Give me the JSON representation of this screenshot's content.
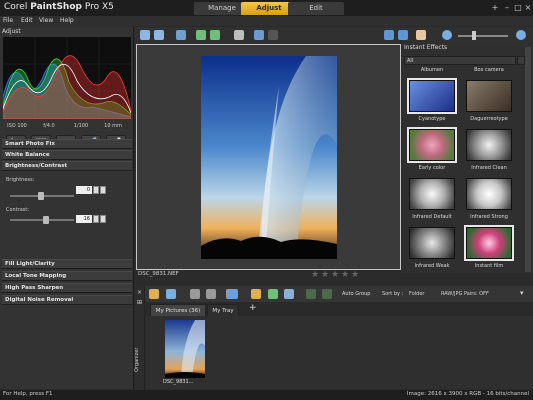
{
  "app": {
    "brand": "Corel",
    "product": "PaintShop",
    "version": "Pro X5"
  },
  "mode_tabs": [
    {
      "label": "Manage",
      "active": false
    },
    {
      "label": "Adjust",
      "active": true
    },
    {
      "label": "Edit",
      "active": false
    }
  ],
  "window_controls": [
    "+",
    "–",
    "□",
    "×"
  ],
  "menu": [
    "File",
    "Edit",
    "View",
    "Help"
  ],
  "left_panel": {
    "title": "Adjust",
    "histogram_colors": [
      "#ff3030",
      "#30e030",
      "#3060ff",
      "#ffffff"
    ],
    "exif": [
      "ISO 100",
      "f/4.0",
      "1/100",
      "10 mm"
    ],
    "tools": [
      "crop-icon",
      "straighten-icon",
      "red-eye-icon",
      "retouch-icon",
      "makeover-icon"
    ],
    "sections_top": [
      "Smart Photo Fix",
      "White Balance",
      "Brightness/Contrast"
    ],
    "brightness": {
      "label": "Brightness:",
      "value": "0"
    },
    "contrast": {
      "label": "Contrast:",
      "value": "16"
    },
    "sections_bottom": [
      "Fill Light/Clarity",
      "Local Tone Mapping",
      "High Pass Sharpen",
      "Digital Noise Removal"
    ]
  },
  "main_toolbar": [
    "save-icon",
    "save-as-icon",
    "share-icon",
    "rotate-left-icon",
    "rotate-right-icon",
    "delete-icon",
    "undo-icon",
    "redo-icon"
  ],
  "view_toolbar": [
    "actual-size-icon",
    "fit-window-icon",
    "pan-icon",
    "zoom-out-icon",
    "zoom-slider",
    "zoom-in-icon"
  ],
  "canvas": {
    "filename": "DSC_9831.NEF",
    "rating_max": 5,
    "rating": 0
  },
  "instant_effects": {
    "title": "Instant Effects",
    "filter": "All",
    "top_labels": [
      "Albumen",
      "Box camera"
    ],
    "items": [
      {
        "label": "Cyanotype",
        "color": "#3a55b0",
        "selected": true
      },
      {
        "label": "Daguerreotype",
        "color": "#5a4c3c",
        "selected": false
      },
      {
        "label": "Early color",
        "color": "#c06a80",
        "selected": true
      },
      {
        "label": "Infrared Clean",
        "color": "#bcbcbc",
        "selected": false
      },
      {
        "label": "Infrared Default",
        "color": "#cfcfcf",
        "selected": false
      },
      {
        "label": "Infrared Strong",
        "color": "#e0e0e0",
        "selected": false
      },
      {
        "label": "Infrared Weak",
        "color": "#a8a8a8",
        "selected": false
      },
      {
        "label": "Instant film",
        "color": "#d0407a",
        "selected": true
      }
    ]
  },
  "organizer": {
    "side_label": "Organizer",
    "tabs": [
      {
        "label": "My Pictures (36)",
        "active": false
      },
      {
        "label": "My Tray",
        "active": true
      }
    ],
    "add_tab": "+",
    "auto_group": "Auto Group",
    "sort_by": "Sort by :",
    "sort_value": "Folder",
    "raw_pairs": "RAW/JPG Pairs: OFF",
    "thumb_label": "DSC_9831..."
  },
  "status": {
    "left": "For Help, press F1",
    "right": "Image: 2616 x 3900 x RGB - 16 bits/channel"
  }
}
